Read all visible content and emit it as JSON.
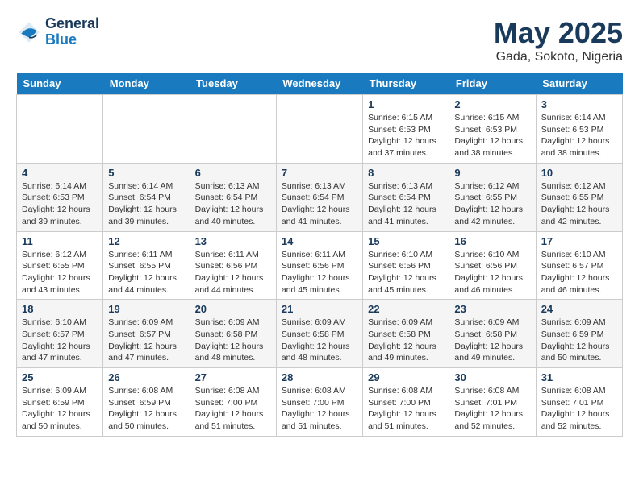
{
  "header": {
    "logo_line1": "General",
    "logo_line2": "Blue",
    "month": "May 2025",
    "location": "Gada, Sokoto, Nigeria"
  },
  "days_of_week": [
    "Sunday",
    "Monday",
    "Tuesday",
    "Wednesday",
    "Thursday",
    "Friday",
    "Saturday"
  ],
  "weeks": [
    [
      {
        "day": "",
        "info": ""
      },
      {
        "day": "",
        "info": ""
      },
      {
        "day": "",
        "info": ""
      },
      {
        "day": "",
        "info": ""
      },
      {
        "day": "1",
        "info": "Sunrise: 6:15 AM\nSunset: 6:53 PM\nDaylight: 12 hours\nand 37 minutes."
      },
      {
        "day": "2",
        "info": "Sunrise: 6:15 AM\nSunset: 6:53 PM\nDaylight: 12 hours\nand 38 minutes."
      },
      {
        "day": "3",
        "info": "Sunrise: 6:14 AM\nSunset: 6:53 PM\nDaylight: 12 hours\nand 38 minutes."
      }
    ],
    [
      {
        "day": "4",
        "info": "Sunrise: 6:14 AM\nSunset: 6:53 PM\nDaylight: 12 hours\nand 39 minutes."
      },
      {
        "day": "5",
        "info": "Sunrise: 6:14 AM\nSunset: 6:54 PM\nDaylight: 12 hours\nand 39 minutes."
      },
      {
        "day": "6",
        "info": "Sunrise: 6:13 AM\nSunset: 6:54 PM\nDaylight: 12 hours\nand 40 minutes."
      },
      {
        "day": "7",
        "info": "Sunrise: 6:13 AM\nSunset: 6:54 PM\nDaylight: 12 hours\nand 41 minutes."
      },
      {
        "day": "8",
        "info": "Sunrise: 6:13 AM\nSunset: 6:54 PM\nDaylight: 12 hours\nand 41 minutes."
      },
      {
        "day": "9",
        "info": "Sunrise: 6:12 AM\nSunset: 6:55 PM\nDaylight: 12 hours\nand 42 minutes."
      },
      {
        "day": "10",
        "info": "Sunrise: 6:12 AM\nSunset: 6:55 PM\nDaylight: 12 hours\nand 42 minutes."
      }
    ],
    [
      {
        "day": "11",
        "info": "Sunrise: 6:12 AM\nSunset: 6:55 PM\nDaylight: 12 hours\nand 43 minutes."
      },
      {
        "day": "12",
        "info": "Sunrise: 6:11 AM\nSunset: 6:55 PM\nDaylight: 12 hours\nand 44 minutes."
      },
      {
        "day": "13",
        "info": "Sunrise: 6:11 AM\nSunset: 6:56 PM\nDaylight: 12 hours\nand 44 minutes."
      },
      {
        "day": "14",
        "info": "Sunrise: 6:11 AM\nSunset: 6:56 PM\nDaylight: 12 hours\nand 45 minutes."
      },
      {
        "day": "15",
        "info": "Sunrise: 6:10 AM\nSunset: 6:56 PM\nDaylight: 12 hours\nand 45 minutes."
      },
      {
        "day": "16",
        "info": "Sunrise: 6:10 AM\nSunset: 6:56 PM\nDaylight: 12 hours\nand 46 minutes."
      },
      {
        "day": "17",
        "info": "Sunrise: 6:10 AM\nSunset: 6:57 PM\nDaylight: 12 hours\nand 46 minutes."
      }
    ],
    [
      {
        "day": "18",
        "info": "Sunrise: 6:10 AM\nSunset: 6:57 PM\nDaylight: 12 hours\nand 47 minutes."
      },
      {
        "day": "19",
        "info": "Sunrise: 6:09 AM\nSunset: 6:57 PM\nDaylight: 12 hours\nand 47 minutes."
      },
      {
        "day": "20",
        "info": "Sunrise: 6:09 AM\nSunset: 6:58 PM\nDaylight: 12 hours\nand 48 minutes."
      },
      {
        "day": "21",
        "info": "Sunrise: 6:09 AM\nSunset: 6:58 PM\nDaylight: 12 hours\nand 48 minutes."
      },
      {
        "day": "22",
        "info": "Sunrise: 6:09 AM\nSunset: 6:58 PM\nDaylight: 12 hours\nand 49 minutes."
      },
      {
        "day": "23",
        "info": "Sunrise: 6:09 AM\nSunset: 6:58 PM\nDaylight: 12 hours\nand 49 minutes."
      },
      {
        "day": "24",
        "info": "Sunrise: 6:09 AM\nSunset: 6:59 PM\nDaylight: 12 hours\nand 50 minutes."
      }
    ],
    [
      {
        "day": "25",
        "info": "Sunrise: 6:09 AM\nSunset: 6:59 PM\nDaylight: 12 hours\nand 50 minutes."
      },
      {
        "day": "26",
        "info": "Sunrise: 6:08 AM\nSunset: 6:59 PM\nDaylight: 12 hours\nand 50 minutes."
      },
      {
        "day": "27",
        "info": "Sunrise: 6:08 AM\nSunset: 7:00 PM\nDaylight: 12 hours\nand 51 minutes."
      },
      {
        "day": "28",
        "info": "Sunrise: 6:08 AM\nSunset: 7:00 PM\nDaylight: 12 hours\nand 51 minutes."
      },
      {
        "day": "29",
        "info": "Sunrise: 6:08 AM\nSunset: 7:00 PM\nDaylight: 12 hours\nand 51 minutes."
      },
      {
        "day": "30",
        "info": "Sunrise: 6:08 AM\nSunset: 7:01 PM\nDaylight: 12 hours\nand 52 minutes."
      },
      {
        "day": "31",
        "info": "Sunrise: 6:08 AM\nSunset: 7:01 PM\nDaylight: 12 hours\nand 52 minutes."
      }
    ]
  ]
}
